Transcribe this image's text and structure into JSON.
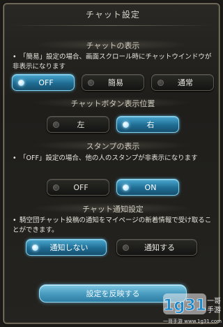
{
  "header": {
    "title": "チャット設定"
  },
  "sections": [
    {
      "title": "チャットの表示",
      "description": "「簡易」設定の場合、画面スクロール時にチャットウインドウが非表示になります",
      "options": [
        {
          "label": "OFF",
          "selected": true
        },
        {
          "label": "簡易",
          "selected": false
        },
        {
          "label": "通常",
          "selected": false
        }
      ]
    },
    {
      "title": "チャットボタン表示位置",
      "options": [
        {
          "label": "左",
          "selected": false
        },
        {
          "label": "右",
          "selected": true
        }
      ]
    },
    {
      "title": "スタンプの表示",
      "description": "「OFF」設定の場合、他の人のスタンプが非表示になります",
      "options": [
        {
          "label": "OFF",
          "selected": false
        },
        {
          "label": "ON",
          "selected": true
        }
      ]
    },
    {
      "title": "チャット通知設定",
      "description": "騎空団チャット投稿の通知をマイページの新着情報で受け取ることができます。",
      "options": [
        {
          "label": "通知しない",
          "selected": true
        },
        {
          "label": "通知する",
          "selected": false
        }
      ]
    }
  ],
  "apply_button": {
    "label": "設定を反映する"
  },
  "watermark": {
    "logo_text": "1g31",
    "brand": "一哥手游",
    "caption": "一哥手游 www.1g31.com"
  }
}
